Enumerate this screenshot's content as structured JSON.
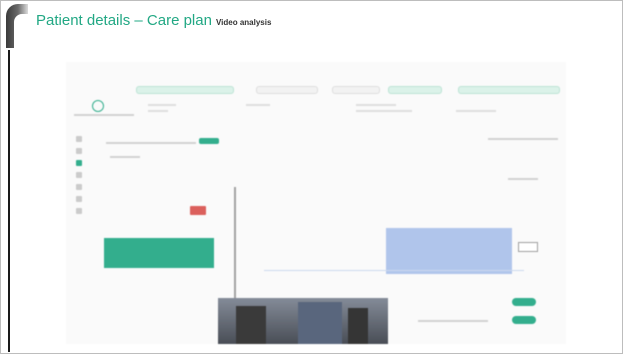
{
  "slide": {
    "title": "Patient details – Care plan",
    "subtitle": "Video analysis"
  },
  "colors": {
    "accent": "#22a884",
    "alert": "#d9534f",
    "bar": "#aac1ea"
  },
  "screenshot_icons": [
    "patient-icon",
    "sidebar-icons"
  ]
}
